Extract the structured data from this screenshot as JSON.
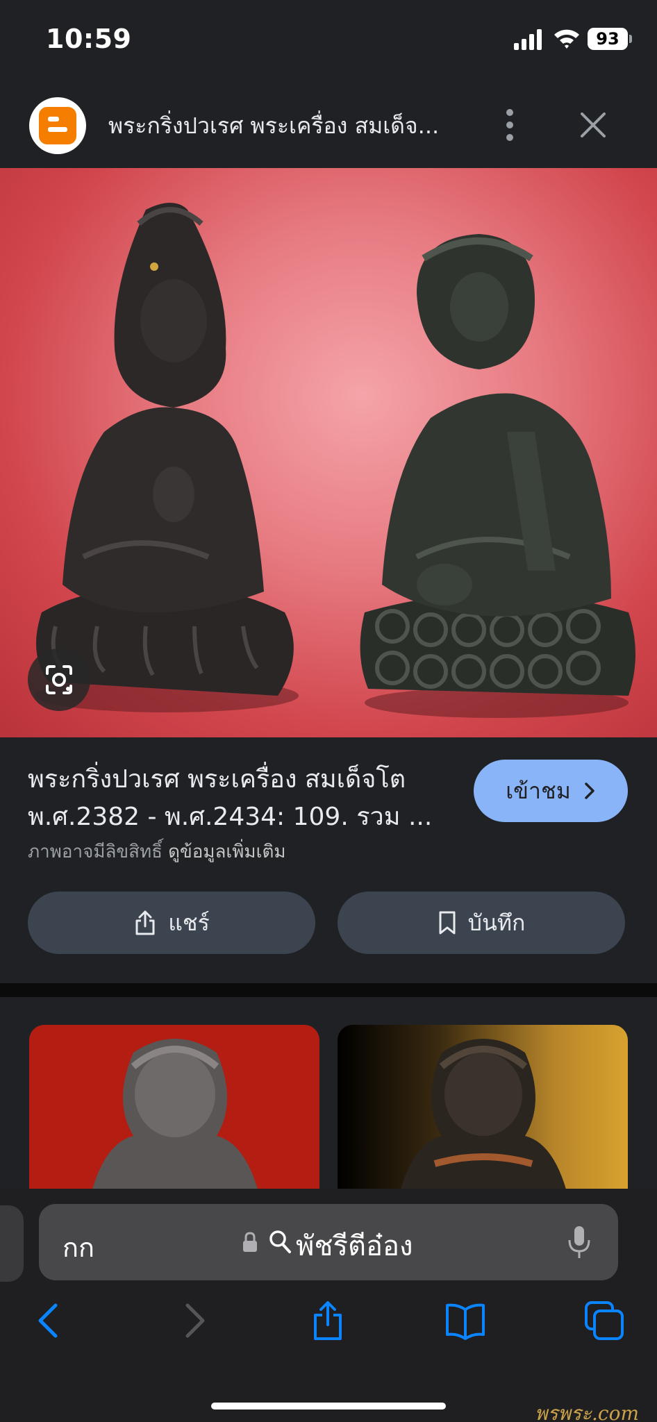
{
  "status_bar": {
    "time": "10:59",
    "battery": "93"
  },
  "header": {
    "title": "พระกริ่งปวเรศ พระเครื่อง สมเด็จ..."
  },
  "info": {
    "title_line1": "พระกริ่งปวเรศ พระเครื่อง สมเด็จโต",
    "title_line2": "พ.ศ.2382 - พ.ศ.2434: 109. รวม ...",
    "visit_label": "เข้าชม",
    "copyright_note": "ภาพอาจมีลิขสิทธิ์",
    "more_info_link": "ดูข้อมูลเพิ่มเติม",
    "share_label": "แชร์",
    "save_label": "บันทึก"
  },
  "address_bar": {
    "aa_label": "กก",
    "query": "พัชรีตีอ๋อง"
  },
  "watermark": "พรพระ.com",
  "colors": {
    "accent": "#8ab4f8",
    "ios_blue": "#0a84ff",
    "background": "#202124"
  }
}
